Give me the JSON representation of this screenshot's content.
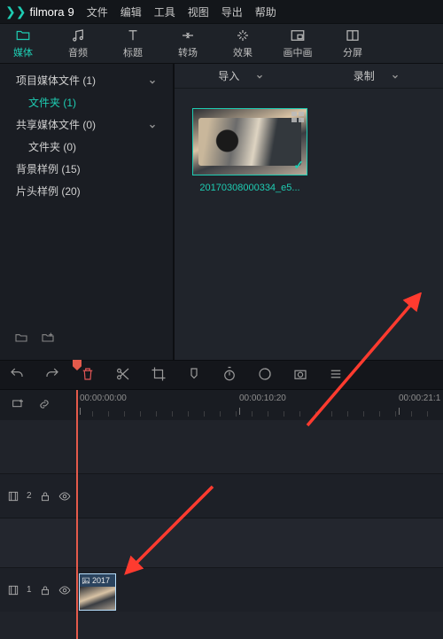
{
  "app": {
    "name": "filmora",
    "version": "9"
  },
  "menubar": [
    "文件",
    "编辑",
    "工具",
    "视图",
    "导出",
    "帮助"
  ],
  "tooltabs": [
    {
      "label": "媒体",
      "icon": "folder-icon",
      "active": true
    },
    {
      "label": "音频",
      "icon": "music-icon",
      "active": false
    },
    {
      "label": "标题",
      "icon": "text-icon",
      "active": false
    },
    {
      "label": "转场",
      "icon": "transition-icon",
      "active": false
    },
    {
      "label": "效果",
      "icon": "sparkle-icon",
      "active": false
    },
    {
      "label": "画中画",
      "icon": "pip-icon",
      "active": false
    },
    {
      "label": "分屏",
      "icon": "split-icon",
      "active": false
    }
  ],
  "sidebar": {
    "items": [
      {
        "label": "项目媒体文件 (1)",
        "expandable": true
      },
      {
        "label": "文件夹  (1)",
        "sub": true,
        "selected": true
      },
      {
        "label": "共享媒体文件 (0)",
        "expandable": true
      },
      {
        "label": "文件夹 (0)",
        "sub": true
      },
      {
        "label": "背景样例 (15)"
      },
      {
        "label": "片头样例 (20)"
      }
    ]
  },
  "mediabar": {
    "import_label": "导入",
    "record_label": "录制"
  },
  "media_items": [
    {
      "name": "20170308000334_e5...",
      "selected": true
    }
  ],
  "toolbar_icons": [
    "undo-icon",
    "redo-icon",
    "delete-icon",
    "scissors-icon",
    "crop-icon",
    "marker-icon",
    "stopwatch-icon",
    "color-icon",
    "freeze-icon",
    "list-icon"
  ],
  "timeline": {
    "ruler": [
      "00:00:00:00",
      "00:00:10:20",
      "00:00:21:1"
    ],
    "tracks": [
      {
        "name": "2",
        "icon": "film-icon"
      },
      {
        "name": "1",
        "icon": "film-icon"
      }
    ],
    "clip_label": "2017"
  },
  "colors": {
    "accent": "#1ecdb3",
    "arrow": "#ff3b2f"
  }
}
